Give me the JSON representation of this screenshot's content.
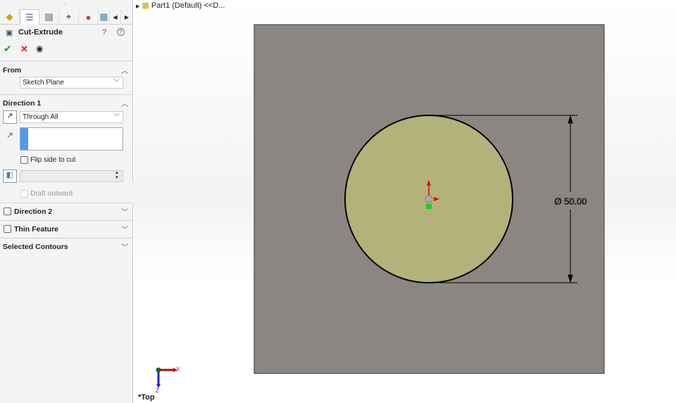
{
  "panel": {
    "title": "Cut-Extrude",
    "from": {
      "heading": "From",
      "value": "Sketch Plane"
    },
    "direction1": {
      "heading": "Direction 1",
      "end_condition": "Through All",
      "flip_label": "Flip side to cut",
      "draft_label": "Draft outward"
    },
    "direction2": {
      "heading": "Direction 2"
    },
    "thin": {
      "heading": "Thin Feature"
    },
    "contours": {
      "heading": "Selected Contours"
    }
  },
  "tree": {
    "root": "Part1 (Default) <<D..."
  },
  "viewport": {
    "dimension": "Ø 50.00",
    "dimension_value": "50.00",
    "view_name": "*Top",
    "axis_x": "X",
    "axis_z": "Z"
  },
  "colors": {
    "plate": "#8a8782",
    "circle": "#b2b27a",
    "accent": "#4a9cf2"
  }
}
